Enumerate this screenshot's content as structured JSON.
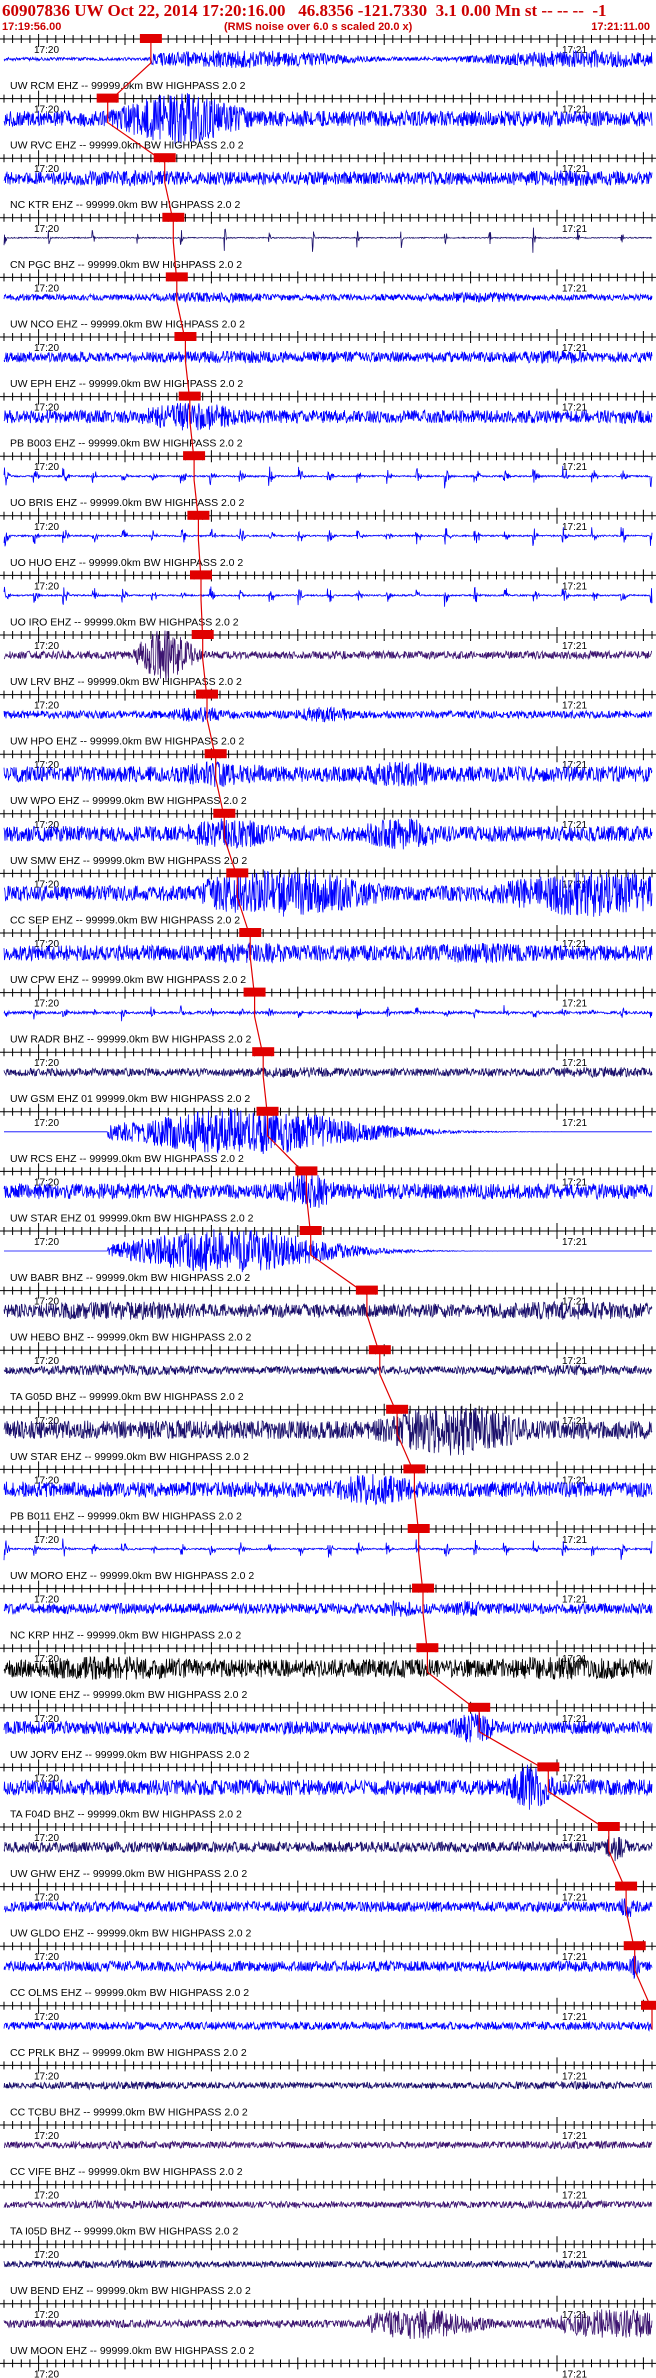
{
  "header": {
    "title": "60907836 UW Oct 22, 2014 17:20:16.00   46.8356 -121.7330  3.1 0.00 Mn st -- -- --  -1",
    "start_time": "17:19:56.00",
    "note": "(RMS noise over 6.0 s scaled 20.0 x)",
    "end_time": "17:21:11.00"
  },
  "colors": {
    "header_text": "#cc0000",
    "pick_box": "#e00000",
    "axis": "#000000",
    "trace_blue": "#0000ff",
    "trace_navy": "#1a0f6b",
    "trace_black": "#000000",
    "trace_purple": "#3c1470"
  },
  "chart_data": {
    "type": "line",
    "plot_kind": "seismogram record section",
    "time_axis": {
      "start": "17:19:56.00",
      "end": "17:21:11.00",
      "tick_labels": [
        "17:20",
        "17:21"
      ]
    },
    "traces": [
      {
        "name": "UW RCM EHZ -- 99999.0km BW  HIGHPASS  2.0  2",
        "pick_time": "17:20:13.0",
        "energy_start_s": 17,
        "energy_end_s": 75,
        "peak": 0.35,
        "noise": 0.06,
        "color": "blue",
        "style": "noise"
      },
      {
        "name": "UW RVC EHZ -- 99999.0km BW  HIGHPASS  2.0  2",
        "pick_time": "17:20:08.0",
        "energy_start_s": 12,
        "energy_end_s": 40,
        "peak": 1.0,
        "noise": 0.3,
        "color": "blue",
        "style": "burst"
      },
      {
        "name": "NC KTR EHZ -- 99999.0km BW  HIGHPASS  2.0  2",
        "pick_time": "17:20:14.6",
        "energy_start_s": 0,
        "energy_end_s": 75,
        "peak": 0.3,
        "noise": 0.25,
        "color": "blue",
        "style": "noise"
      },
      {
        "name": "CN PGC BHZ -- 99999.0km BW  HIGHPASS  2.0  2",
        "pick_time": "17:20:15.6",
        "energy_start_s": 0,
        "energy_end_s": 75,
        "peak": 0.6,
        "noise": 0.02,
        "color": "navy",
        "style": "spikes"
      },
      {
        "name": "UW NCO EHZ -- 99999.0km BW  HIGHPASS  2.0  2",
        "pick_time": "17:20:16.0",
        "energy_start_s": 16,
        "energy_end_s": 60,
        "peak": 0.2,
        "noise": 0.12,
        "color": "blue",
        "style": "noise"
      },
      {
        "name": "UW EPH EHZ -- 99999.0km BW  HIGHPASS  2.0  2",
        "pick_time": "17:20:17.0",
        "energy_start_s": 17,
        "energy_end_s": 70,
        "peak": 0.25,
        "noise": 0.2,
        "color": "blue",
        "style": "noise"
      },
      {
        "name": "PB B003 EHZ -- 99999.0km BW  HIGHPASS  2.0  2",
        "pick_time": "17:20:17.5",
        "energy_start_s": 14,
        "energy_end_s": 40,
        "peak": 0.55,
        "noise": 0.25,
        "color": "blue",
        "style": "burst"
      },
      {
        "name": "UO BRIS EHZ -- 99999.0km BW  HIGHPASS  2.0  2",
        "pick_time": "17:20:18.0",
        "energy_start_s": 0,
        "energy_end_s": 75,
        "peak": 0.55,
        "noise": 0.03,
        "color": "blue",
        "style": "bursts"
      },
      {
        "name": "UO HUO EHZ -- 99999.0km BW  HIGHPASS  2.0  2",
        "pick_time": "17:20:18.5",
        "energy_start_s": 0,
        "energy_end_s": 75,
        "peak": 0.55,
        "noise": 0.03,
        "color": "blue",
        "style": "bursts"
      },
      {
        "name": "UO IRO EHZ -- 99999.0km BW  HIGHPASS  2.0  2",
        "pick_time": "17:20:18.8",
        "energy_start_s": 0,
        "energy_end_s": 75,
        "peak": 0.5,
        "noise": 0.03,
        "color": "blue",
        "style": "bursts"
      },
      {
        "name": "UW LRV BHZ -- 99999.0km BW  HIGHPASS  2.0  2",
        "pick_time": "17:20:19.0",
        "energy_start_s": 15,
        "energy_end_s": 27,
        "peak": 1.0,
        "noise": 0.15,
        "color": "purple",
        "style": "burst"
      },
      {
        "name": "UW HPO EHZ -- 99999.0km BW  HIGHPASS  2.0  2",
        "pick_time": "17:20:19.5",
        "energy_start_s": 19,
        "energy_end_s": 40,
        "peak": 0.3,
        "noise": 0.15,
        "color": "blue",
        "style": "noise"
      },
      {
        "name": "UW WPO EHZ -- 99999.0km BW  HIGHPASS  2.0  2",
        "pick_time": "17:20:20.5",
        "energy_start_s": 20,
        "energy_end_s": 50,
        "peak": 0.5,
        "noise": 0.3,
        "color": "blue",
        "style": "noise"
      },
      {
        "name": "UW SMW EHZ -- 99999.0km BW  HIGHPASS  2.0  2",
        "pick_time": "17:20:21.5",
        "energy_start_s": 21,
        "energy_end_s": 50,
        "peak": 0.6,
        "noise": 0.3,
        "color": "blue",
        "style": "noise"
      },
      {
        "name": "CC SEP EHZ -- 99999.0km BW  HIGHPASS  2.0  2",
        "pick_time": "17:20:23.0",
        "energy_start_s": 23,
        "energy_end_s": 75,
        "peak": 0.9,
        "noise": 0.3,
        "color": "blue",
        "style": "noise"
      },
      {
        "name": "UW CPW EHZ -- 99999.0km BW  HIGHPASS  2.0  2",
        "pick_time": "17:20:24.5",
        "energy_start_s": 22,
        "energy_end_s": 60,
        "peak": 0.4,
        "noise": 0.3,
        "color": "blue",
        "style": "noise"
      },
      {
        "name": "UW RADR BHZ -- 99999.0km BW  HIGHPASS  2.0  2",
        "pick_time": "17:20:25.0",
        "energy_start_s": 0,
        "energy_end_s": 75,
        "peak": 0.35,
        "noise": 0.05,
        "color": "blue",
        "style": "bursts"
      },
      {
        "name": "UW GSM EHZ 01 99999.0km BW  HIGHPASS  2.0  2",
        "pick_time": "17:20:26.0",
        "energy_start_s": 25,
        "energy_end_s": 75,
        "peak": 0.2,
        "noise": 0.15,
        "color": "navy",
        "style": "noise"
      },
      {
        "name": "UW RCS EHZ -- 99999.0km BW  HIGHPASS  2.0  2",
        "pick_time": "17:20:26.5",
        "energy_start_s": 12,
        "energy_end_s": 65,
        "peak": 0.9,
        "noise": 0.0,
        "color": "blue",
        "style": "burst"
      },
      {
        "name": "UW STAR EHZ 01 99999.0km BW  HIGHPASS  2.0  2",
        "pick_time": "17:20:31.0",
        "energy_start_s": 31,
        "energy_end_s": 45,
        "peak": 0.7,
        "noise": 0.3,
        "color": "blue",
        "style": "burst"
      },
      {
        "name": "UW BABR BHZ -- 99999.0km BW  HIGHPASS  2.0  2",
        "pick_time": "17:20:31.5",
        "energy_start_s": 12,
        "energy_end_s": 58,
        "peak": 0.85,
        "noise": 0.0,
        "color": "blue",
        "style": "burst"
      },
      {
        "name": "UW HEBO BHZ -- 99999.0km BW  HIGHPASS  2.0  2",
        "pick_time": "17:20:38.0",
        "energy_start_s": 0,
        "energy_end_s": 75,
        "peak": 0.35,
        "noise": 0.25,
        "color": "navy",
        "style": "noise"
      },
      {
        "name": "TA G05D BHZ -- 99999.0km BW  HIGHPASS  2.0  2",
        "pick_time": "17:20:39.5",
        "energy_start_s": 0,
        "energy_end_s": 75,
        "peak": 0.2,
        "noise": 0.15,
        "color": "navy",
        "style": "noise"
      },
      {
        "name": "UW STAR EHZ -- 99999.0km BW  HIGHPASS  2.0  2",
        "pick_time": "17:20:41.5",
        "energy_start_s": 42,
        "energy_end_s": 75,
        "peak": 1.0,
        "noise": 0.35,
        "color": "navy",
        "style": "burst"
      },
      {
        "name": "PB B011 EHZ -- 99999.0km BW  HIGHPASS  2.0  2",
        "pick_time": "17:20:43.5",
        "energy_start_s": 35,
        "energy_end_s": 60,
        "peak": 0.6,
        "noise": 0.3,
        "color": "blue",
        "style": "burst"
      },
      {
        "name": "UW MORO EHZ -- 99999.0km BW  HIGHPASS  2.0  2",
        "pick_time": "17:20:44.0",
        "energy_start_s": 0,
        "energy_end_s": 75,
        "peak": 0.5,
        "noise": 0.03,
        "color": "blue",
        "style": "bursts"
      },
      {
        "name": "NC KRP HHZ -- 99999.0km BW  HIGHPASS  2.0  2",
        "pick_time": "17:20:44.5",
        "energy_start_s": 44,
        "energy_end_s": 55,
        "peak": 0.35,
        "noise": 0.2,
        "color": "blue",
        "style": "noise"
      },
      {
        "name": "UW IONE EHZ -- 99999.0km BW  HIGHPASS  2.0  2",
        "pick_time": "17:20:45.0",
        "energy_start_s": 0,
        "energy_end_s": 75,
        "peak": 0.45,
        "noise": 0.35,
        "color": "black",
        "style": "noise"
      },
      {
        "name": "UW JORV EHZ -- 99999.0km BW  HIGHPASS  2.0  2",
        "pick_time": "17:20:51.0",
        "energy_start_s": 51,
        "energy_end_s": 62,
        "peak": 0.6,
        "noise": 0.25,
        "color": "blue",
        "style": "burst"
      },
      {
        "name": "TA F04D BHZ -- 99999.0km BW  HIGHPASS  2.0  2",
        "pick_time": "17:20:59.0",
        "energy_start_s": 58,
        "energy_end_s": 68,
        "peak": 0.9,
        "noise": 0.3,
        "color": "blue",
        "style": "burst"
      },
      {
        "name": "UW GHW EHZ -- 99999.0km BW  HIGHPASS  2.0  2",
        "pick_time": "17:21:06.0",
        "energy_start_s": 69,
        "energy_end_s": 75,
        "peak": 0.55,
        "noise": 0.2,
        "color": "navy",
        "style": "burst"
      },
      {
        "name": "UW GLDO EHZ -- 99999.0km BW  HIGHPASS  2.0  2",
        "pick_time": "17:21:08.0",
        "energy_start_s": 71,
        "energy_end_s": 75,
        "peak": 0.45,
        "noise": 0.2,
        "color": "blue",
        "style": "burst"
      },
      {
        "name": "CC OLMS EHZ -- 99999.0km BW  HIGHPASS  2.0  2",
        "pick_time": "17:21:09.0",
        "energy_start_s": 72,
        "energy_end_s": 75,
        "peak": 0.5,
        "noise": 0.2,
        "color": "blue",
        "style": "burst"
      },
      {
        "name": "CC PRLK BHZ -- 99999.0km BW  HIGHPASS  2.0  2",
        "pick_time": "17:21:11.0",
        "energy_start_s": 73,
        "energy_end_s": 75,
        "peak": 0.25,
        "noise": 0.15,
        "color": "blue",
        "style": "noise"
      },
      {
        "name": "CC TCBU BHZ -- 99999.0km BW  HIGHPASS  2.0  2",
        "pick_time": "",
        "energy_start_s": 0,
        "energy_end_s": 75,
        "peak": 0.15,
        "noise": 0.12,
        "color": "navy",
        "style": "noise"
      },
      {
        "name": "CC VIFE BHZ -- 99999.0km BW  HIGHPASS  2.0  2",
        "pick_time": "",
        "energy_start_s": 0,
        "energy_end_s": 75,
        "peak": 0.15,
        "noise": 0.12,
        "color": "purple",
        "style": "noise"
      },
      {
        "name": "TA I05D BHZ -- 99999.0km BW  HIGHPASS  2.0  2",
        "pick_time": "",
        "energy_start_s": 0,
        "energy_end_s": 75,
        "peak": 0.15,
        "noise": 0.12,
        "color": "purple",
        "style": "noise"
      },
      {
        "name": "UW BEND EHZ -- 99999.0km BW  HIGHPASS  2.0  2",
        "pick_time": "",
        "energy_start_s": 0,
        "energy_end_s": 75,
        "peak": 0.15,
        "noise": 0.12,
        "color": "navy",
        "style": "noise"
      },
      {
        "name": "UW MOON EHZ -- 99999.0km BW  HIGHPASS  2.0  2",
        "pick_time": "",
        "energy_start_s": 42,
        "energy_end_s": 75,
        "peak": 0.6,
        "noise": 0.15,
        "color": "purple",
        "style": "noise"
      },
      {
        "name": "",
        "pick_time": "",
        "energy_start_s": 0,
        "energy_end_s": 75,
        "peak": 0.15,
        "noise": 0.15,
        "color": "blue",
        "style": "noise"
      },
      {
        "name": "",
        "pick_time": "",
        "energy_start_s": 0,
        "energy_end_s": 75,
        "peak": 0.15,
        "noise": 0.12,
        "color": "blue",
        "style": "noise"
      }
    ]
  }
}
